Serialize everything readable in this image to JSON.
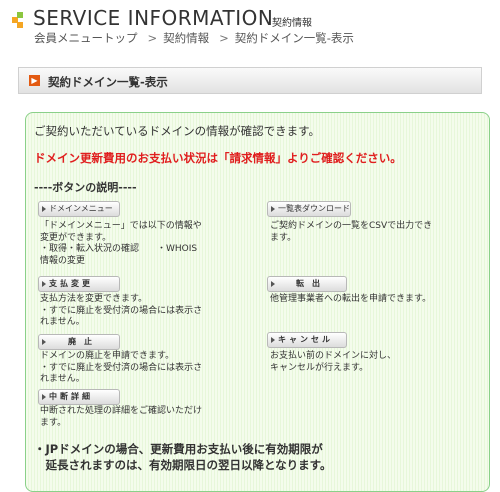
{
  "header": {
    "title": "SERVICE INFORMATION",
    "subtitle": "契約情報",
    "logo_colors": [
      "#f5a623",
      "#8cc63f",
      "#f5a623"
    ]
  },
  "breadcrumb": [
    "会員メニュートップ",
    "契約情報",
    "契約ドメイン一覧-表示"
  ],
  "breadcrumb_sep": ">",
  "section": {
    "title": "契約ドメイン一覧-表示",
    "icon": "orange-arrow-icon"
  },
  "panel": {
    "intro": "ご契約いただいているドメインの情報が確認できます。",
    "notice": "ドメイン更新費用のお支払い状況は「請求情報」よりご確認ください。",
    "buttons_heading": "----ボタンの説明----",
    "buttons": {
      "domain_menu": {
        "label": "ドメインメニュー",
        "desc": [
          "「ドメインメニュー」では以下の情報や",
          "変更ができます。",
          "・取得・転入状況の確認　　・WHOIS",
          "情報の変更"
        ]
      },
      "list_download": {
        "label": "一覧表ダウンロード",
        "desc": [
          "ご契約ドメインの一覧をCSVで出力でき",
          "ます。"
        ]
      },
      "payment_change": {
        "label": "支払変更",
        "desc": [
          "支払方法を変更できます。",
          "・すでに廃止を受付済の場合には表示さ",
          "れません。"
        ]
      },
      "transfer_out": {
        "label": "転出",
        "desc": [
          "他管理事業者への転出を申請できます。"
        ]
      },
      "abolish": {
        "label": "廃止",
        "desc": [
          "ドメインの廃止を申請できます。",
          "・すでに廃止を受付済の場合には表示さ",
          "れません。"
        ]
      },
      "cancel": {
        "label": "キャンセル",
        "desc": [
          "お支払い前のドメインに対し、",
          "キャンセルが行えます。"
        ]
      },
      "suspend_detail": {
        "label": "中断詳細",
        "desc": [
          "中断された処理の詳細をご確認いただけ",
          "ます。"
        ]
      }
    },
    "footnote": [
      "・JPドメインの場合、更新費用お支払い後に有効期限が",
      "　延長されますのは、有効期限日の翌日以降となります。"
    ]
  },
  "colors": {
    "notice": "#e01e1e",
    "accent": "#e35a12",
    "panel_border": "#8ad089"
  }
}
